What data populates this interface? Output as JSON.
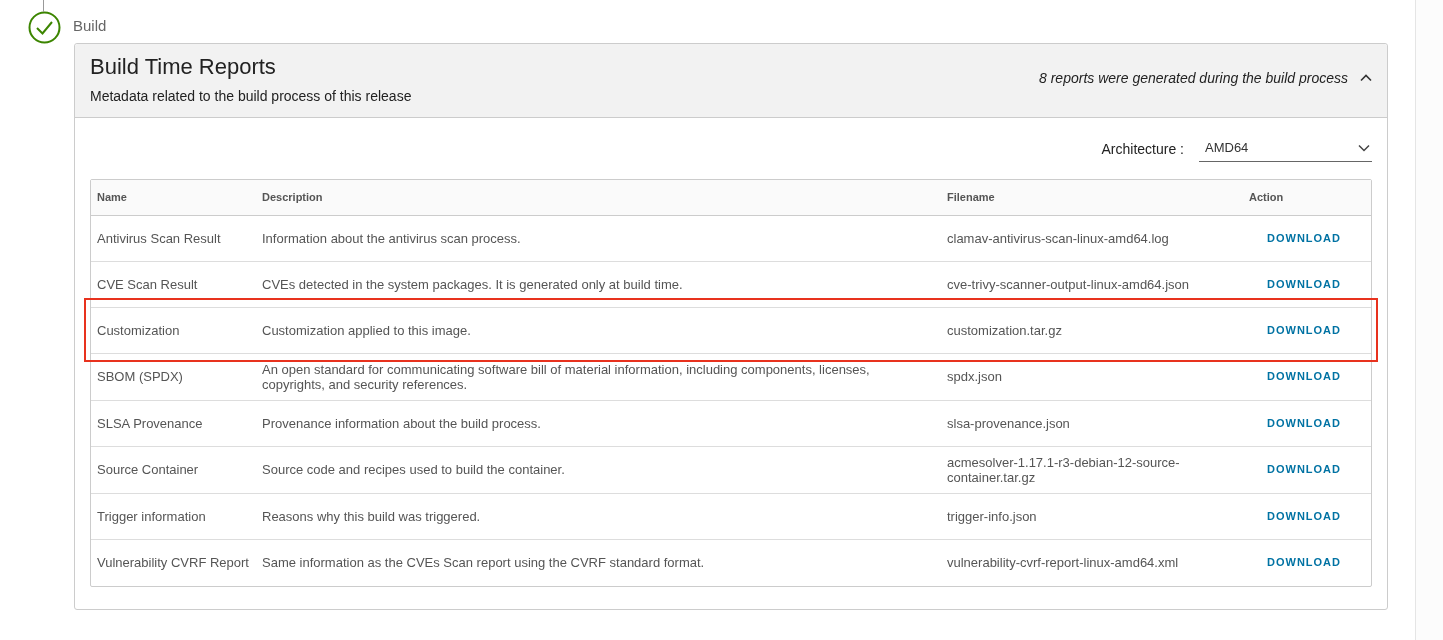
{
  "step": {
    "label": "Build",
    "completed": true
  },
  "card": {
    "title": "Build Time Reports",
    "subtitle": "Metadata related to the build process of this release",
    "summary": "8 reports were generated during the build process",
    "expanded": true
  },
  "architecture": {
    "label": "Architecture :",
    "value": "AMD64"
  },
  "table": {
    "columns": [
      "Name",
      "Description",
      "Filename",
      "Action"
    ],
    "rows": [
      {
        "name": "Antivirus Scan Result",
        "description": "Information about the antivirus scan process.",
        "filename": "clamav-antivirus-scan-linux-amd64.log",
        "action": "DOWNLOAD",
        "highlighted": false
      },
      {
        "name": "CVE Scan Result",
        "description": "CVEs detected in the system packages. It is generated only at build time.",
        "filename": "cve-trivy-scanner-output-linux-amd64.json",
        "action": "DOWNLOAD",
        "highlighted": false
      },
      {
        "name": "Customization",
        "description": "Customization applied to this image.",
        "filename": "customization.tar.gz",
        "action": "DOWNLOAD",
        "highlighted": true
      },
      {
        "name": "SBOM (SPDX)",
        "description": "An open standard for communicating software bill of material information, including components, licenses, copyrights, and security references.",
        "filename": "spdx.json",
        "action": "DOWNLOAD",
        "highlighted": false
      },
      {
        "name": "SLSA Provenance",
        "description": "Provenance information about the build process.",
        "filename": "slsa-provenance.json",
        "action": "DOWNLOAD",
        "highlighted": false
      },
      {
        "name": "Source Container",
        "description": "Source code and recipes used to build the container.",
        "filename": "acmesolver-1.17.1-r3-debian-12-source-container.tar.gz",
        "action": "DOWNLOAD",
        "highlighted": false
      },
      {
        "name": "Trigger information",
        "description": "Reasons why this build was triggered.",
        "filename": "trigger-info.json",
        "action": "DOWNLOAD",
        "highlighted": false
      },
      {
        "name": "Vulnerability CVRF Report",
        "description": "Same information as the CVEs Scan report using the CVRF standard format.",
        "filename": "vulnerability-cvrf-report-linux-amd64.xml",
        "action": "DOWNLOAD",
        "highlighted": false
      }
    ]
  }
}
